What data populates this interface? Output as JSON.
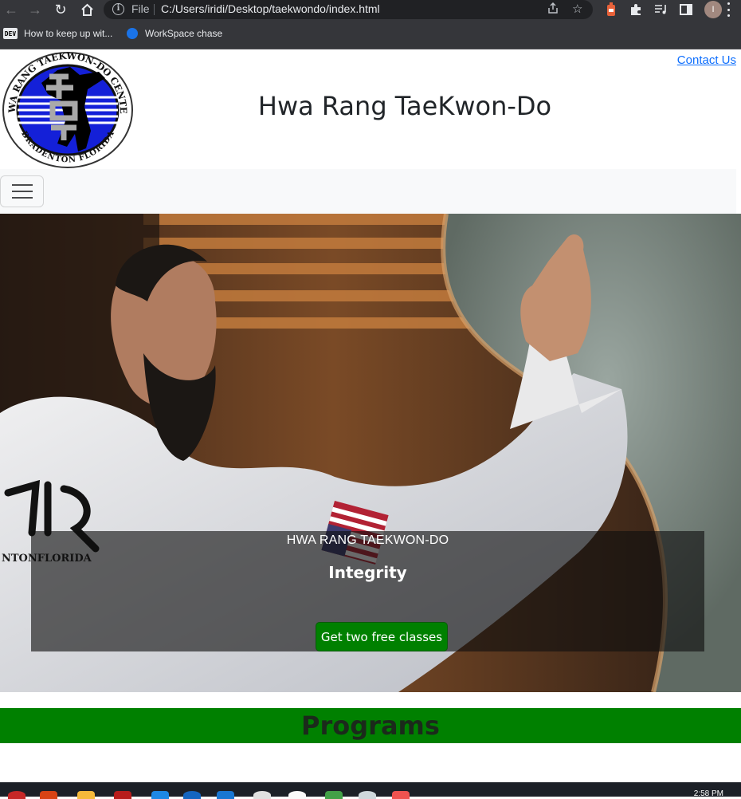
{
  "browser": {
    "address_scheme_label": "File",
    "url": "C:/Users/iridi/Desktop/taekwondo/index.html",
    "profile_initial": "I",
    "bookmarks": [
      {
        "label": "How to keep up wit...",
        "icon": "dev-icon"
      },
      {
        "label": "WorkSpace chase",
        "icon": "globe-icon"
      }
    ]
  },
  "header": {
    "logo_text_top": "HWA RANG TAEKWON-DO CENTER",
    "logo_text_bottom": "BRADENTON FLORIDA",
    "contact_link": "Contact Us",
    "title": "Hwa Rang TaeKwon-Do"
  },
  "hero": {
    "kicker": "HWA RANG TAEKWON-DO",
    "motto": "Integrity",
    "cta_label": "Get two free classes",
    "patch_text": "NTONFLORIDA"
  },
  "sections": {
    "programs_heading": "Programs"
  },
  "taskbar": {
    "clock": "2:58 PM"
  },
  "colors": {
    "brand_green": "#008000",
    "link_blue": "#0d6efd",
    "chrome_dark": "#35363a"
  }
}
